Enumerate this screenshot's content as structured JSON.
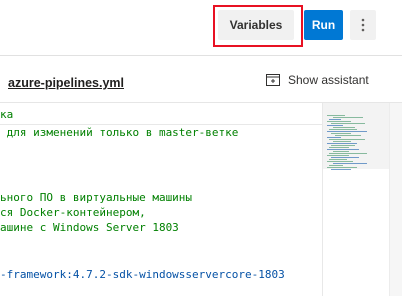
{
  "toolbar": {
    "variables_label": "Variables",
    "run_label": "Run",
    "more_icon": "more-vertical-icon"
  },
  "file": {
    "name": "azure-pipelines.yml",
    "assistant_label": "Show assistant",
    "assistant_icon": "assistant-panel-icon"
  },
  "editor": {
    "lines": [
      "ка",
      " для изменений только в master-ветке",
      "ьного ПО в виртуальные машины",
      "ся Docker-контейнером,",
      "ашине с Windows Server 1803",
      "-framework:4.7.2-sdk-windowsservercore-1803"
    ]
  },
  "colors": {
    "accent": "#0078d4",
    "highlight": "#e81123",
    "comment": "#008000",
    "string": "#0451a5"
  }
}
